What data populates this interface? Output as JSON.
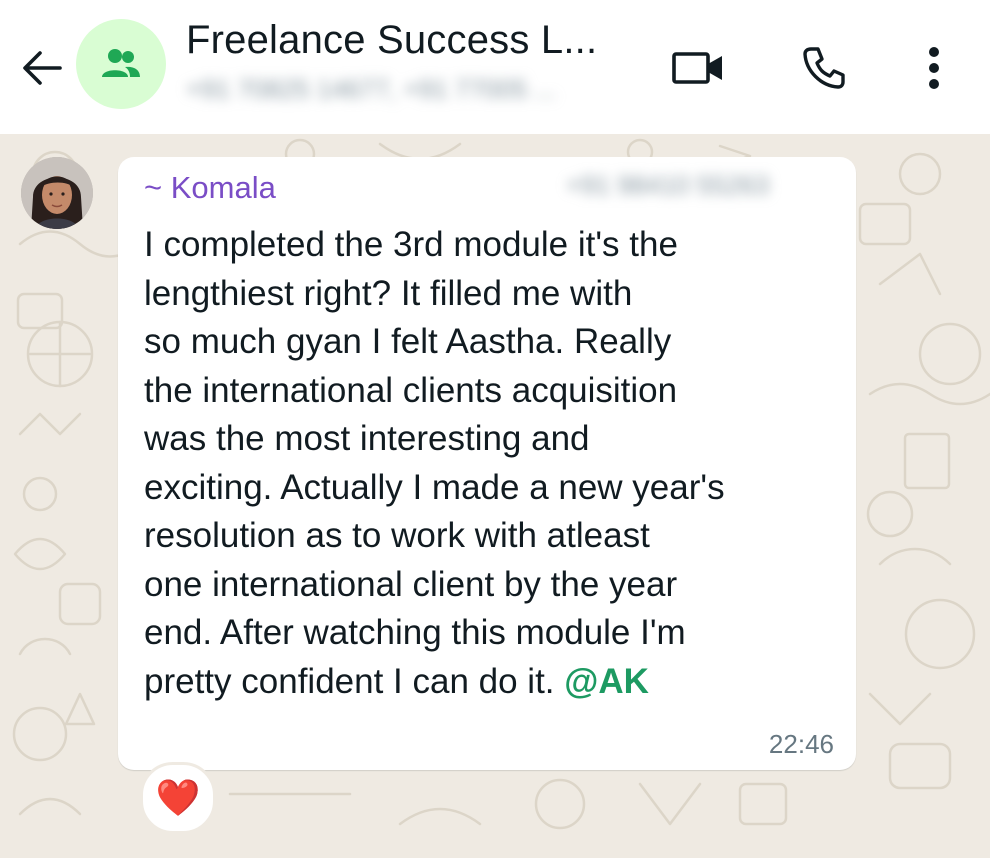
{
  "header": {
    "title": "Freelance Success L...",
    "subtitle": "+91 70825 14677, +91 77005 ...",
    "icons": {
      "back": "arrow-left-icon",
      "group_avatar": "group-icon",
      "video_call": "video-camera-icon",
      "voice_call": "phone-icon",
      "menu": "more-vert-icon"
    }
  },
  "message": {
    "sender_name": "~ Komala",
    "sender_phone": "+91 98410 55263",
    "lines": [
      "I completed the 3rd module it's the",
      "lengthiest right? It filled me with",
      "so much gyan I felt Aastha. Really",
      "the international clients acquisition",
      "was the most interesting and",
      "exciting. Actually I made a new year's",
      "resolution as to work with atleast",
      "one international client by the year",
      "end. After watching this module I'm",
      "pretty confident I can do it. "
    ],
    "mention": "@AK",
    "time": "22:46",
    "reaction": "❤️"
  },
  "colors": {
    "header_bg": "#ffffff",
    "chat_bg": "#efeae2",
    "bubble_bg": "#ffffff",
    "sender_name": "#7a4dc6",
    "mention": "#1d9a62",
    "accent_green": "#1fa855",
    "avatar_bg": "#d9fdd3"
  }
}
